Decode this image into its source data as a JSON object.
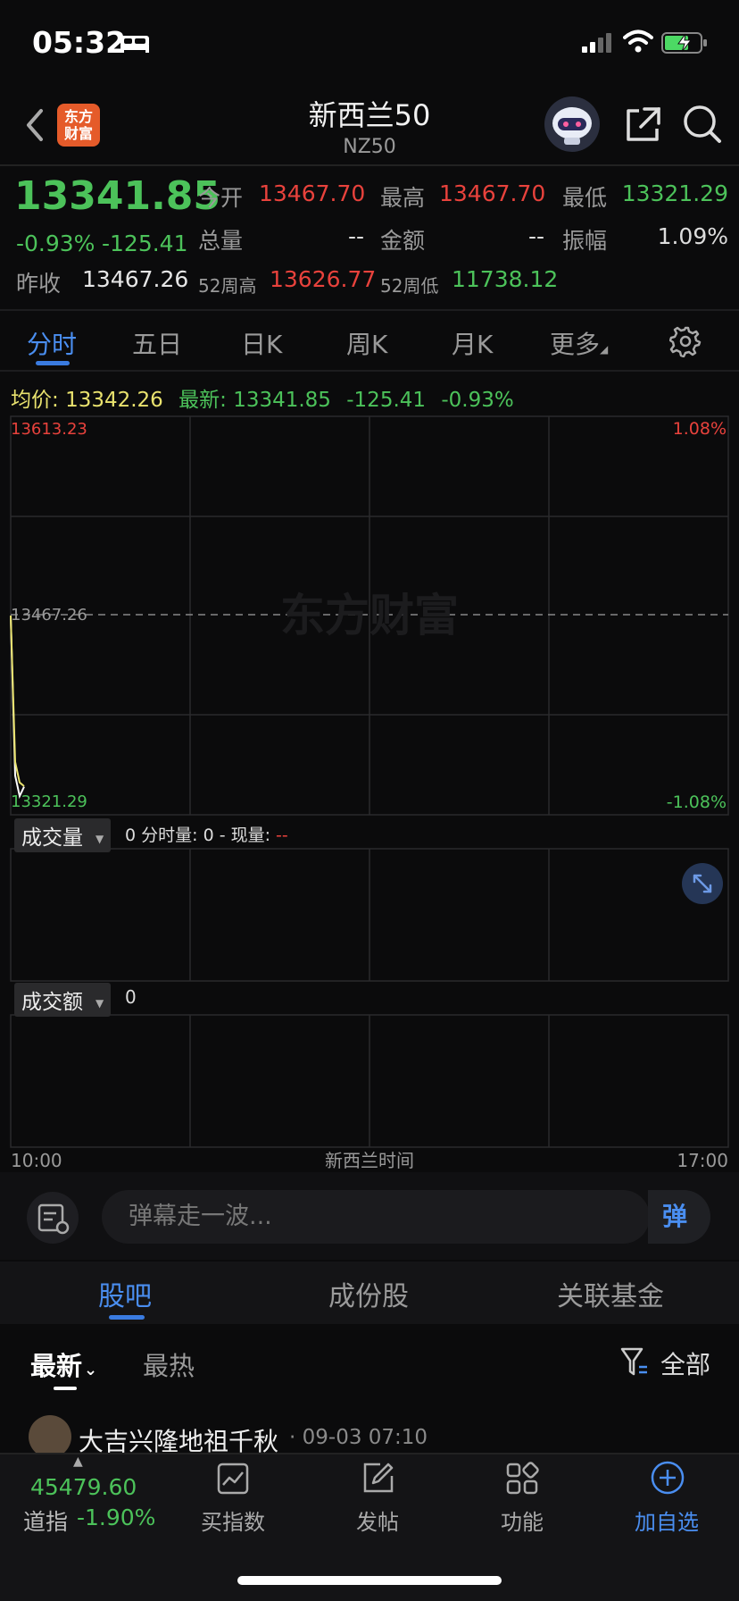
{
  "status_bar": {
    "time": "05:32"
  },
  "header": {
    "logo_line1": "东方",
    "logo_line2": "财富",
    "title": "新西兰50",
    "subtitle": "NZ50"
  },
  "quote": {
    "price": "13341.85",
    "change_pct": "-0.93%",
    "change_abs": "-125.41",
    "open_label": "今开",
    "open": "13467.70",
    "high_label": "最高",
    "high": "13467.70",
    "low_label": "最低",
    "low": "13321.29",
    "volume_label": "总量",
    "volume": "--",
    "amount_label": "金额",
    "amount": "--",
    "amplitude_label": "振幅",
    "amplitude": "1.09%",
    "prev_close_label": "昨收",
    "prev_close": "13467.26",
    "wk52_high_label": "52周高",
    "wk52_high": "13626.77",
    "wk52_low_label": "52周低",
    "wk52_low": "11738.12"
  },
  "tabs": [
    "分时",
    "五日",
    "日K",
    "周K",
    "月K",
    "更多"
  ],
  "legend": {
    "avg_label": "均价:",
    "avg": "13342.26",
    "latest_label": "最新:",
    "latest": "13341.85",
    "latest_change": "-125.41",
    "latest_pct": "-0.93%"
  },
  "chart": {
    "top_price": "13613.23",
    "mid_price": "13467.26",
    "bottom_price": "13321.29",
    "top_pct": "1.08%",
    "bottom_pct": "-1.08%",
    "watermark": "东方财富",
    "volume_dropdown": "成交量",
    "volume_info": "0 分时量: 0 - 现量:",
    "volume_now": "--",
    "amount_dropdown": "成交额",
    "amount_info": "0",
    "time_start": "10:00",
    "time_mid": "新西兰时间",
    "time_end": "17:00"
  },
  "chart_data": {
    "type": "line",
    "ylim": [
      13321.29,
      13613.23
    ],
    "reference": 13467.26,
    "series": [
      {
        "values": [
          13467.26,
          13350.0,
          13335.0,
          13341.85
        ]
      },
      {
        "values": [
          13467.26,
          13360.0,
          13345.0,
          13342.26
        ]
      }
    ]
  },
  "danmu": {
    "placeholder": "弹幕走一波...",
    "send": "弹"
  },
  "sub_tabs": [
    "股吧",
    "成份股",
    "关联基金"
  ],
  "sort": {
    "newest": "最新",
    "hot": "最热",
    "filter": "全部"
  },
  "post": {
    "author": "大吉兴隆地祖千秋",
    "time": "· 09-03 07:10"
  },
  "bottom_nav": {
    "dow_value": "45479.60",
    "dow_label": "道指",
    "dow_pct": "-1.90%",
    "items": [
      "买指数",
      "发帖",
      "功能",
      "加自选"
    ]
  }
}
